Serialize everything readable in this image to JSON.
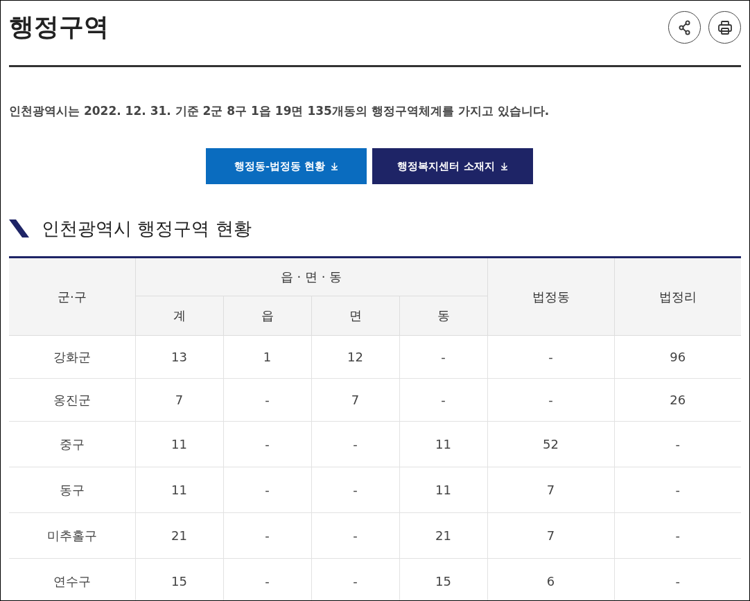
{
  "page": {
    "title": "행정구역"
  },
  "actions": [
    {
      "kind": "share"
    },
    {
      "kind": "print"
    }
  ],
  "summary": "인천광역시는 2022. 12. 31. 기준  2군 8구 1읍 19면 135개동의 행정구역체계를 가지고 있습니다.",
  "download_buttons": [
    {
      "label": "행정동-법정동 현황",
      "color": "#0a6cbf"
    },
    {
      "label": "행정복지센터 소재지",
      "color": "#1e2466"
    }
  ],
  "section": {
    "title": "인천광역시 행정구역 현황"
  },
  "table": {
    "group_header": "읍 · 면 · 동",
    "columns": [
      "군·구",
      "계",
      "읍",
      "면",
      "동",
      "법정동",
      "법정리"
    ],
    "rows": [
      [
        "강화군",
        "13",
        "1",
        "12",
        "-",
        "-",
        "96"
      ],
      [
        "옹진군",
        "7",
        "-",
        "7",
        "-",
        "-",
        "26"
      ],
      [
        "중구",
        "11",
        "-",
        "-",
        "11",
        "52",
        "-"
      ],
      [
        "동구",
        "11",
        "-",
        "-",
        "11",
        "7",
        "-"
      ],
      [
        "미추홀구",
        "21",
        "-",
        "-",
        "21",
        "7",
        "-"
      ],
      [
        "연수구",
        "15",
        "-",
        "-",
        "15",
        "6",
        "-"
      ]
    ]
  }
}
